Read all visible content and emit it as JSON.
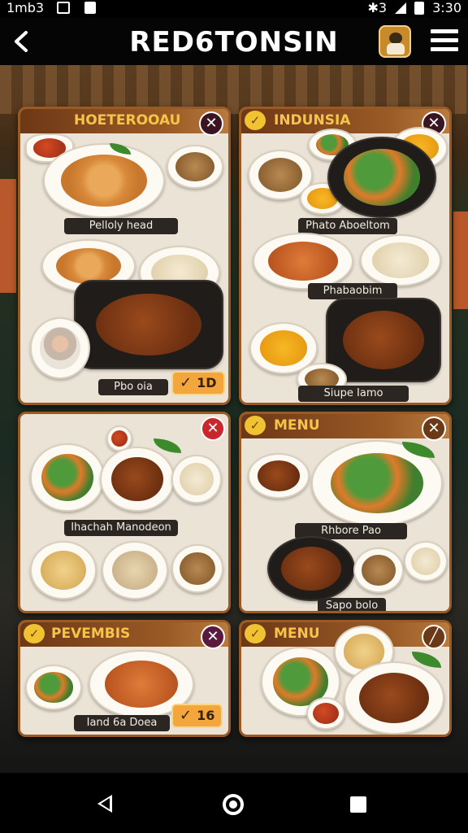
{
  "status_bar": {
    "carrier": "1mb3",
    "time": "3:30",
    "right_symbols": "✱3"
  },
  "app_bar": {
    "title": "RED6TONSIN",
    "back_icon": "chevron-left-icon",
    "chef_icon": "chef-avatar-icon",
    "menu_icon": "hamburger-icon"
  },
  "cards": [
    {
      "title": "HOETEROOAU",
      "labels": [
        "Pelloly head",
        "Pbo oia"
      ],
      "count_badge": "1D",
      "close_symbol": "✕"
    },
    {
      "title": "INDUNSIA",
      "labels": [
        "Phato Aboeltom",
        "Phabaobim",
        "Siupe Iamo"
      ],
      "close_symbol": "✕"
    },
    {
      "title": "",
      "labels": [
        "Ihachah Manodeon"
      ],
      "close_symbol": "✕"
    },
    {
      "title": "MENU",
      "labels": [
        "Rhbore Pao",
        "Sapo bolo"
      ],
      "close_symbol": "✕"
    },
    {
      "title": "PEVEMBIS",
      "labels": [
        "Iand 6a Doea"
      ],
      "count_badge": "16",
      "close_symbol": "✕"
    },
    {
      "title": "MENU",
      "labels": [],
      "close_symbol": "╱"
    }
  ],
  "check_symbol": "✓",
  "badge_check": "✓",
  "colors": {
    "card_border": "#9a5a26",
    "title_gold": "#f7c44a",
    "close_red": "#c9272b",
    "badge_orange": "#f2a63b"
  },
  "nav": {
    "back_icon": "nav-back-icon",
    "home_icon": "nav-home-icon",
    "recent_icon": "nav-recents-icon"
  }
}
